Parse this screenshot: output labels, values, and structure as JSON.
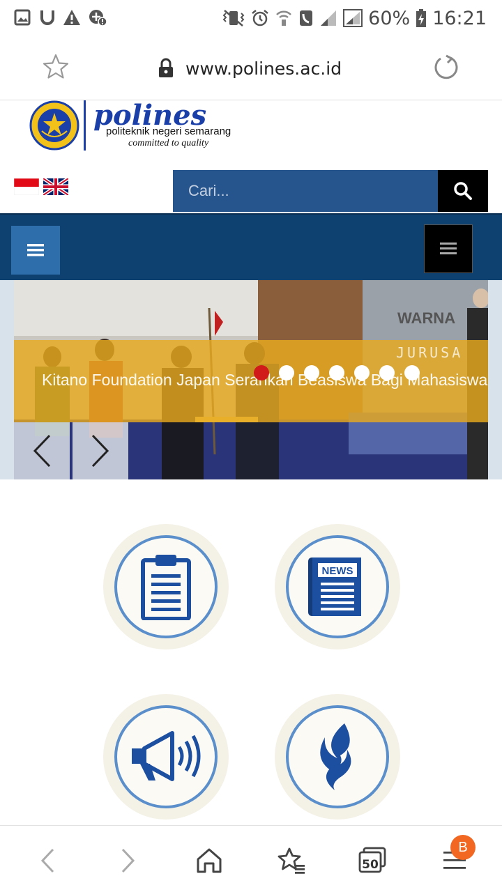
{
  "status_bar": {
    "battery": "60%",
    "time": "16:21",
    "icons": [
      "gallery-icon",
      "magnet-icon",
      "warning-icon",
      "data-saver-icon",
      "vibrate-icon",
      "alarm-icon",
      "wifi-call-icon",
      "signal-icon",
      "signal-roaming-icon",
      "battery-charging-icon"
    ]
  },
  "address_bar": {
    "url": "www.polines.ac.id",
    "icons": [
      "bookmark-star-icon",
      "lock-icon",
      "reload-icon"
    ]
  },
  "header": {
    "logo_wordmark": "polines",
    "logo_subtitle": "politeknik negeri semarang",
    "logo_tagline": "committed to quality",
    "seal_text_top": "Politeknik Negeri",
    "seal_text_bottom": "SEMARANG",
    "languages": [
      "Indonesia",
      "English"
    ],
    "search_placeholder": "Cari..."
  },
  "slider": {
    "caption": "Kitano Foundation Japan Serahkan Beasiswa Bagi Mahasiswa",
    "banner_text": "WARNA",
    "banner_subtext": "JURUSA",
    "slide_count": 7,
    "active_index": 0
  },
  "icon_tiles": [
    {
      "name": "clipboard"
    },
    {
      "name": "news",
      "label": "NEWS"
    },
    {
      "name": "megaphone"
    },
    {
      "name": "flame"
    }
  ],
  "bottom_bar": {
    "tabs_count": "50",
    "menu_badge": "B"
  },
  "colors": {
    "brand_blue": "#0e4070",
    "search_blue": "#26548c",
    "menu_blue": "#2e6fab",
    "caption_gold": "#e8aa1e",
    "active_dot": "#d11a1a",
    "icon_blue": "#1d4fa0",
    "badge_orange": "#f26722"
  }
}
